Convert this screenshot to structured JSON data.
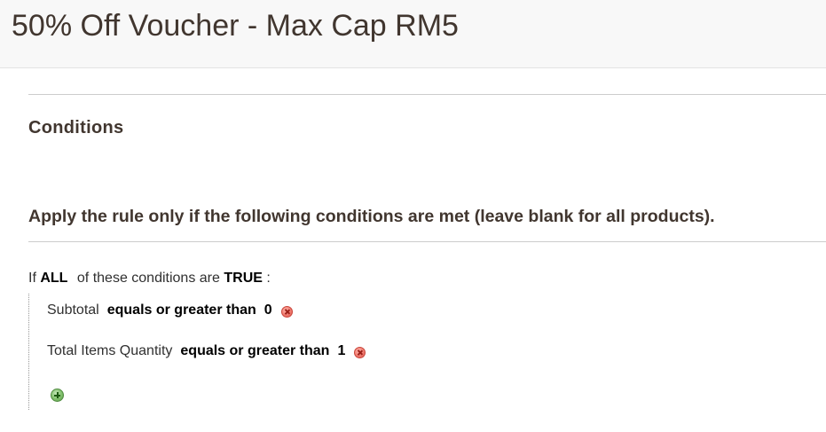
{
  "header": {
    "title": "50% Off Voucher - Max Cap RM5"
  },
  "section": {
    "title": "Conditions"
  },
  "fieldset": {
    "legend": "Apply the rule only if the following conditions are met (leave blank for all products)."
  },
  "rule": {
    "prefix": "If",
    "aggregator": "ALL",
    "middle": "of these conditions are",
    "value": "TRUE",
    "suffix": ":"
  },
  "conditions": [
    {
      "attribute": "Subtotal",
      "operator": "equals or greater than",
      "value": "0",
      "remove_icon": "remove-icon"
    },
    {
      "attribute": "Total Items Quantity",
      "operator": "equals or greater than",
      "value": "1",
      "remove_icon": "remove-icon"
    }
  ],
  "add_icon": "add-icon",
  "colors": {
    "remove": "#e8685c",
    "add": "#6fae5c",
    "header_bg": "#f8f8f8"
  }
}
